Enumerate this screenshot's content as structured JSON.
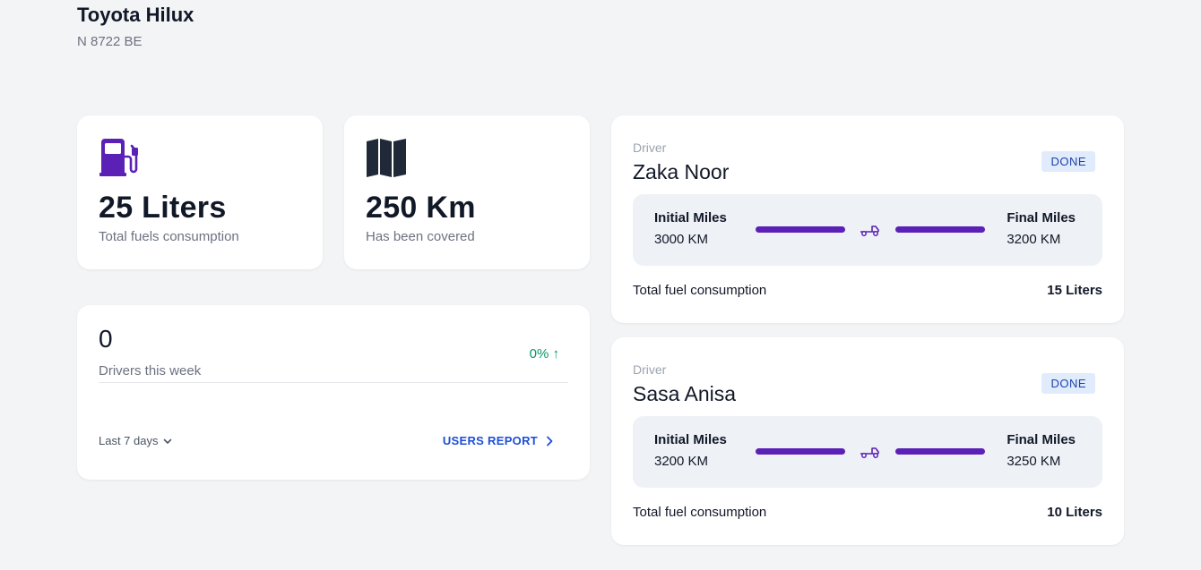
{
  "vehicle": {
    "name": "Toyota Hilux",
    "plate": "N 8722 BE"
  },
  "stats": {
    "fuel": {
      "value": "25 Liters",
      "label": "Total fuels consumption",
      "icon": "fuel-pump-icon",
      "color": "#5b21b6"
    },
    "distance": {
      "value": "250 Km",
      "label": "Has been covered",
      "icon": "map-icon",
      "color": "#1f2937"
    }
  },
  "drivers": {
    "count": "0",
    "label": "Drivers this week",
    "change": "0% ↑",
    "range": "Last 7 days",
    "report_link": "USERS REPORT"
  },
  "trips": [
    {
      "driver_label": "Driver",
      "driver_name": "Zaka Noor",
      "status": "DONE",
      "initial_label": "Initial Miles",
      "initial_value": "3000 KM",
      "final_label": "Final Miles",
      "final_value": "3200 KM",
      "fuel_label": "Total fuel consumption",
      "fuel_value": "15 Liters"
    },
    {
      "driver_label": "Driver",
      "driver_name": "Sasa Anisa",
      "status": "DONE",
      "initial_label": "Initial Miles",
      "initial_value": "3200 KM",
      "final_label": "Final Miles",
      "final_value": "3250 KM",
      "fuel_label": "Total fuel consumption",
      "fuel_value": "10 Liters"
    }
  ],
  "colors": {
    "accent": "#5b21b6",
    "link": "#1d4ed8",
    "positive": "#059669",
    "badge_bg": "#e0ecfb",
    "badge_text": "#1e40af"
  }
}
